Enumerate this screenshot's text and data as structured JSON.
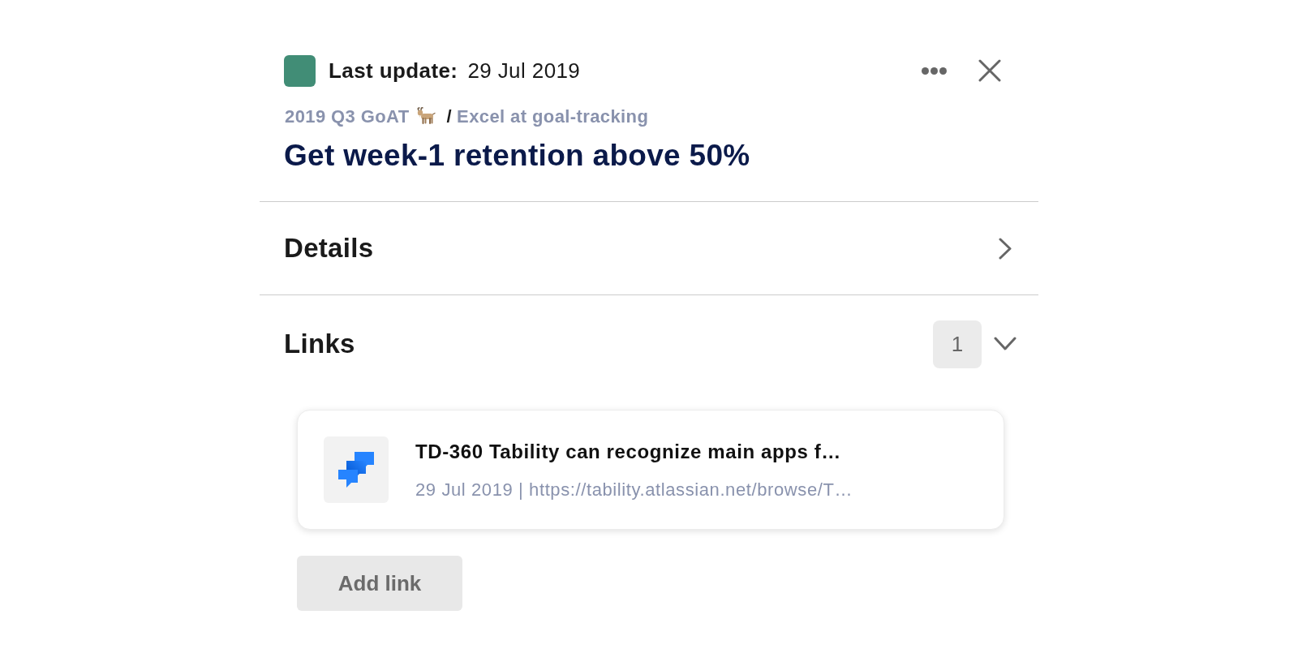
{
  "header": {
    "status": {
      "color": "#418d76"
    },
    "last_update_label": "Last update:",
    "last_update": "29 Jul 2019"
  },
  "breadcrumb": {
    "plan": "2019 Q3 GoAT",
    "separator": "/",
    "objective": "Excel at goal-tracking"
  },
  "title": "Get week-1 retention above 50%",
  "sections": [
    {
      "label": "Details",
      "expanded": false
    },
    {
      "label": "Links",
      "count": "1",
      "expanded": true,
      "links": [
        {
          "title": "TD-360 Tability can recognize main apps f…",
          "meta": "29 Jul 2019 | https://tability.atlassian.net/browse/T…"
        }
      ],
      "add_button": "Add link"
    }
  ]
}
